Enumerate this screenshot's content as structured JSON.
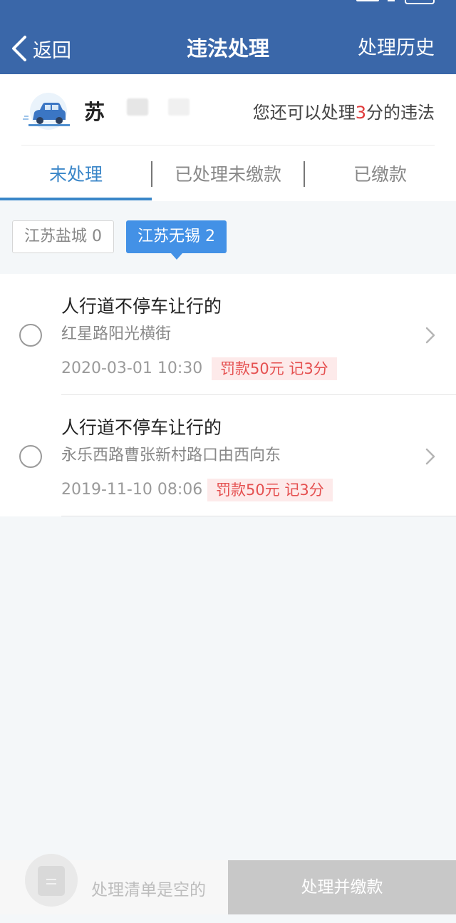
{
  "header": {
    "back_label": "返回",
    "title": "违法处理",
    "history_label": "处理历史",
    "bg_color": "#3a67a9"
  },
  "vehicle": {
    "plate_prefix": "苏",
    "points_prefix": "您还可以处理",
    "points_value": "3",
    "points_suffix": "分的违法"
  },
  "tabs": [
    {
      "label": "未处理",
      "active": true
    },
    {
      "label": "已处理未缴款",
      "active": false
    },
    {
      "label": "已缴款",
      "active": false
    }
  ],
  "regions": [
    {
      "label": "江苏盐城 0",
      "active": false
    },
    {
      "label": "江苏无锡 2",
      "active": true
    }
  ],
  "violations": [
    {
      "title": "人行道不停车让行的",
      "location": "红星路阳光横街",
      "datetime": "2020-03-01 10:30",
      "penalty": "罚款50元  记3分"
    },
    {
      "title": "人行道不停车让行的",
      "location": "永乐西路曹张新村路口由西向东",
      "datetime": "2019-11-10 08:06",
      "penalty": "罚款50元  记3分"
    }
  ],
  "footer": {
    "empty_text": "处理清单是空的",
    "pay_button_label": "处理并缴款"
  },
  "colors": {
    "accent": "#3a86c8",
    "chip_active": "#4391e6",
    "penalty_text": "#e55050",
    "penalty_bg": "#fdeaea"
  }
}
